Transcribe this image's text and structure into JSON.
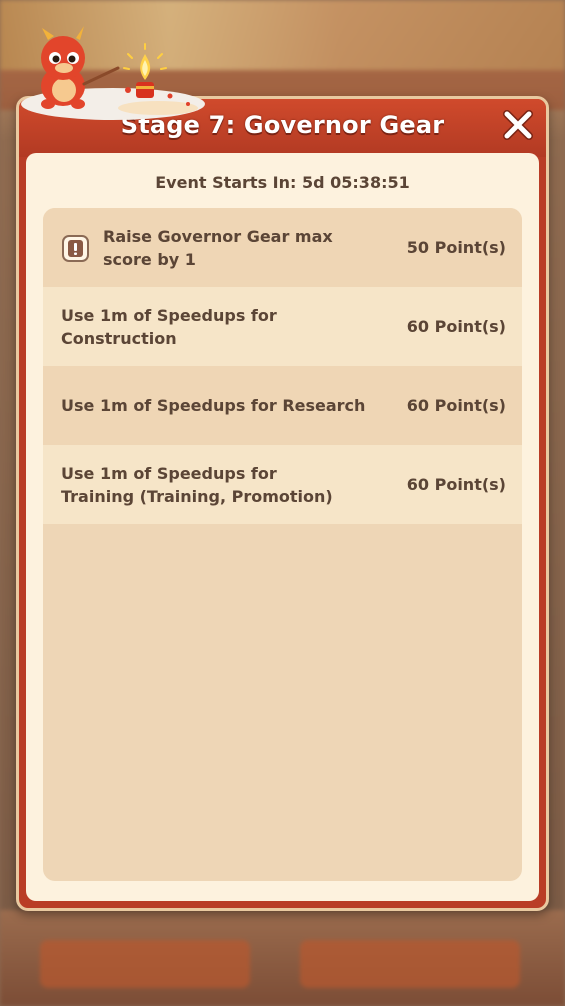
{
  "dialog": {
    "title": "Stage 7: Governor Gear",
    "countdown": "Event Starts In: 5d 05:38:51",
    "close_icon": "close-icon",
    "tasks": [
      {
        "label": "Raise Governor Gear max score by 1",
        "points": "50 Point(s)",
        "icon": "alert-icon"
      },
      {
        "label": "Use 1m of Speedups for Construction",
        "points": "60 Point(s)"
      },
      {
        "label": "Use 1m of Speedups for Research",
        "points": "60 Point(s)"
      },
      {
        "label": "Use 1m of Speedups for Training (Training, Promotion)",
        "points": "60 Point(s)"
      }
    ]
  },
  "colors": {
    "frame": "#b93d26",
    "panel": "#fdf2de",
    "list_bg": "#eed6b6",
    "row_alt": "#f6e5c8",
    "text": "#5b4536"
  }
}
